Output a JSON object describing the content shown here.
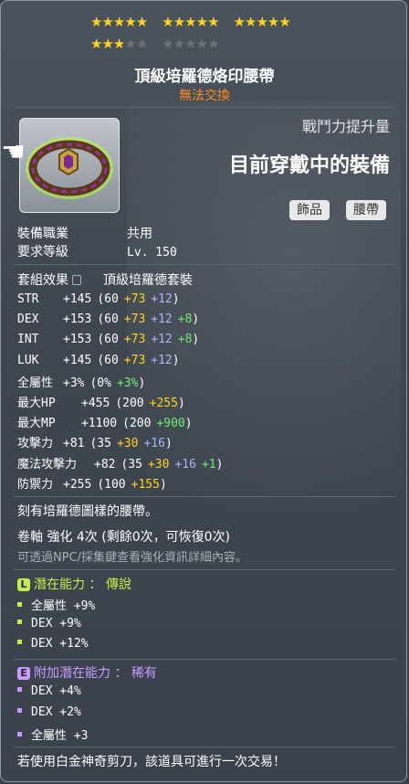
{
  "stars": {
    "filled": 18,
    "total": 25
  },
  "item": {
    "name": "頂級培羅德烙印腰帶",
    "trade": "無法交換"
  },
  "combat": {
    "label": "戰鬥力提升量",
    "value": "目前穿戴中的裝備"
  },
  "tags": [
    "飾品",
    "腰帶"
  ],
  "requirements": [
    {
      "label": "裝備職業",
      "value": "共用"
    },
    {
      "label": "要求等級",
      "value": "Lv. 150"
    }
  ],
  "set": {
    "label": "套組效果",
    "value": "頂級培羅德套裝"
  },
  "stats": [
    {
      "name": "STR",
      "total": "+145",
      "base": "(60",
      "flame": "+73",
      "scroll": "+12",
      "star": "",
      "end": ")"
    },
    {
      "name": "DEX",
      "total": "+153",
      "base": "(60",
      "flame": "+73",
      "scroll": "+12",
      "star": "+8",
      "end": ")"
    },
    {
      "name": "INT",
      "total": "+153",
      "base": "(60",
      "flame": "+73",
      "scroll": "+12",
      "star": "+8",
      "end": ")"
    },
    {
      "name": "LUK",
      "total": "+145",
      "base": "(60",
      "flame": "+73",
      "scroll": "+12",
      "star": "",
      "end": ")"
    },
    {
      "name": "全屬性",
      "total": "+3%",
      "base": "(0%",
      "flame": "",
      "scroll": "",
      "star": "+3%",
      "end": ")"
    },
    {
      "name": "最大HP",
      "total": "+455",
      "base": "(200",
      "flame": "+255",
      "scroll": "",
      "star": "",
      "end": ")"
    },
    {
      "name": "最大MP",
      "total": "+1100",
      "base": "(200",
      "flame": "",
      "scroll": "",
      "star": "+900",
      "end": ")"
    },
    {
      "name": "攻擊力",
      "total": "+81",
      "base": "(35",
      "flame": "+30",
      "scroll": "+16",
      "star": "",
      "end": ")"
    },
    {
      "name": "魔法攻擊力",
      "total": "+82",
      "base": "(35",
      "flame": "+30",
      "scroll": "+16",
      "star": "+1",
      "end": ")"
    },
    {
      "name": "防禦力",
      "total": "+255",
      "base": "(100",
      "flame": "+155",
      "scroll": "",
      "star": "",
      "end": ")"
    }
  ],
  "description": "刻有培羅德圖樣的腰帶。",
  "enhance": "卷軸 強化 4次 (剩餘0次，可恢復0次)",
  "enhance_note": "可透過NPC/採集鍵查看強化資訊詳細內容。",
  "potential": {
    "badge": "L",
    "title": "潛在能力 ： 傳說",
    "color": "#c2f04a",
    "lines": [
      "全屬性 +9%",
      "DEX +9%",
      "DEX +12%"
    ]
  },
  "bonus_potential": {
    "badge": "E",
    "title": "附加潛在能力 ： 稀有",
    "color": "#c89cff",
    "lines": [
      "DEX +4%",
      "DEX +2%",
      "全屬性 +3"
    ]
  },
  "footer": "若使用白金神奇剪刀，該道具可進行一次交易！"
}
